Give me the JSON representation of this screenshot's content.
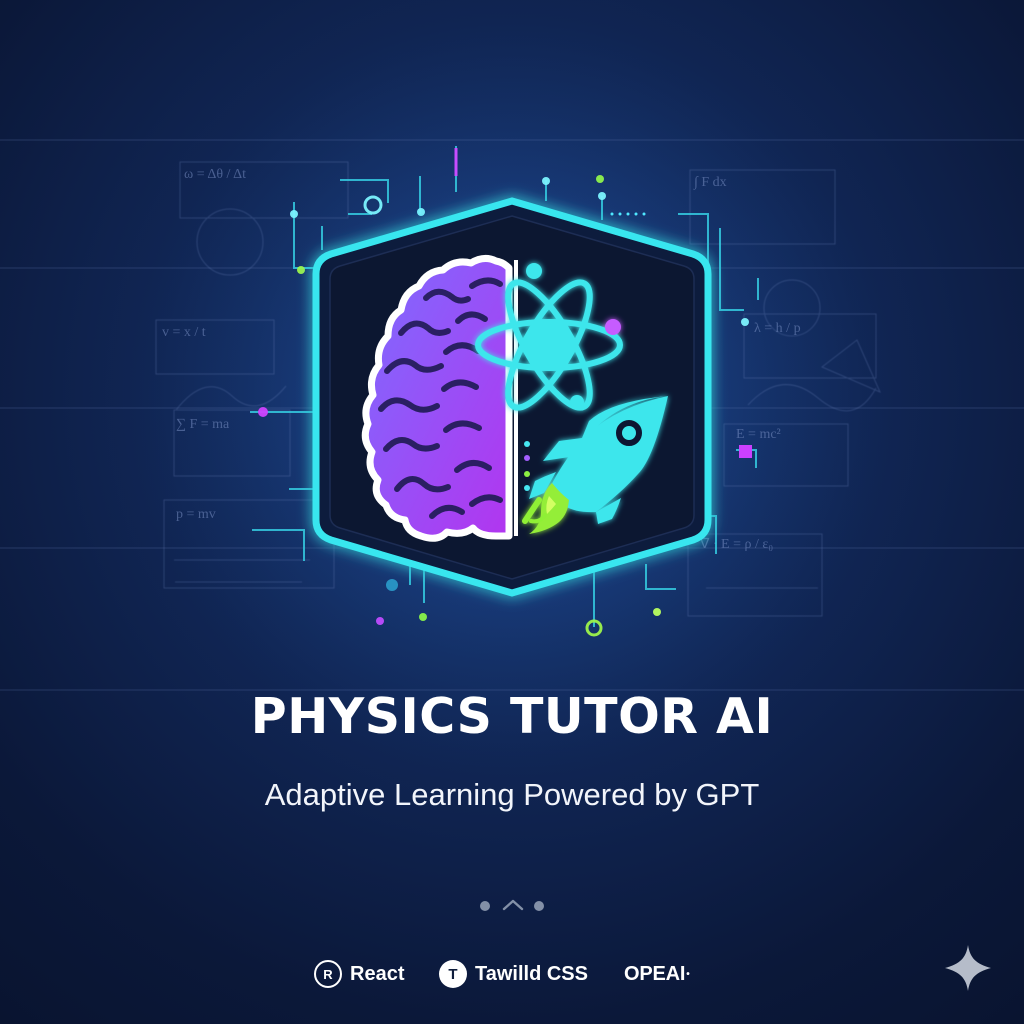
{
  "hero": {
    "title": "PHYSICS TUTOR AI",
    "subtitle": "Adaptive Learning Powered by GPT"
  },
  "pager": {
    "left_dot": "page-dot",
    "center_icon": "chevron-up-icon",
    "right_dot": "page-dot"
  },
  "tech_stack": [
    {
      "label": "React",
      "icon": "react-icon"
    },
    {
      "label": "Tawilld CSS",
      "icon": "tailwind-icon"
    },
    {
      "label": "OPEAI",
      "icon": "openai-icon"
    }
  ],
  "icons": {
    "brain": "brain-icon",
    "atom": "atom-icon",
    "rocket": "rocket-icon",
    "sparkle": "sparkle-icon"
  },
  "colors": {
    "background": "#0f1d3c",
    "accent": "#38e6ef",
    "brain_gradient_start": "#7d6cff",
    "brain_gradient_end": "#b235ef",
    "rocket_flame": "#94ee39",
    "title": "#ffffff"
  }
}
